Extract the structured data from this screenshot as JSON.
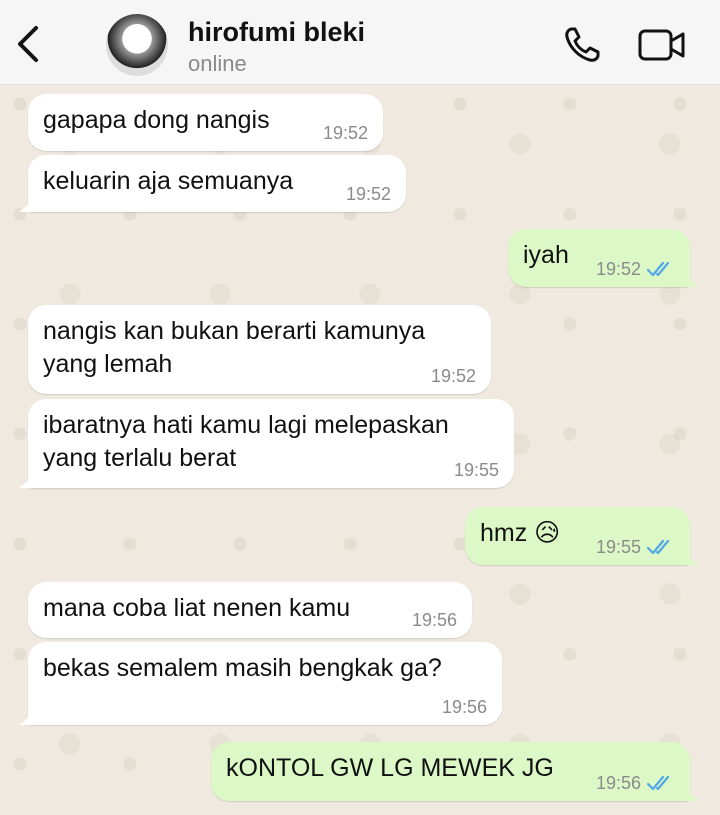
{
  "header": {
    "contact_name": "hirofumi bleki",
    "status": "online"
  },
  "colors": {
    "incoming_bubble": "#ffffff",
    "outgoing_bubble": "#dcf8c6",
    "read_ticks": "#53a6e8",
    "chat_background": "#efe9df"
  },
  "icons": {
    "back": "chevron-left-icon",
    "call": "phone-icon",
    "video": "video-camera-icon",
    "read": "double-check-icon"
  },
  "messages": [
    {
      "direction": "incoming",
      "text": "gapapa dong nangis",
      "time": "19:52"
    },
    {
      "direction": "incoming",
      "text": "keluarin aja semuanya",
      "time": "19:52"
    },
    {
      "direction": "outgoing",
      "text": "iyah",
      "time": "19:52",
      "read": true
    },
    {
      "direction": "incoming",
      "text": "nangis kan bukan berarti kamunya yang lemah",
      "time": "19:52"
    },
    {
      "direction": "incoming",
      "text": "ibaratnya hati kamu lagi melepaskan yang terlalu berat",
      "time": "19:55"
    },
    {
      "direction": "outgoing",
      "text": "hmz 😥",
      "time": "19:55",
      "read": true
    },
    {
      "direction": "incoming",
      "text": "mana coba liat nenen kamu",
      "time": "19:56"
    },
    {
      "direction": "incoming",
      "text": "bekas semalem masih bengkak ga?",
      "time": "19:56"
    },
    {
      "direction": "outgoing",
      "text": "kONTOL GW LG MEWEK JG",
      "time": "19:56",
      "read": true
    }
  ]
}
